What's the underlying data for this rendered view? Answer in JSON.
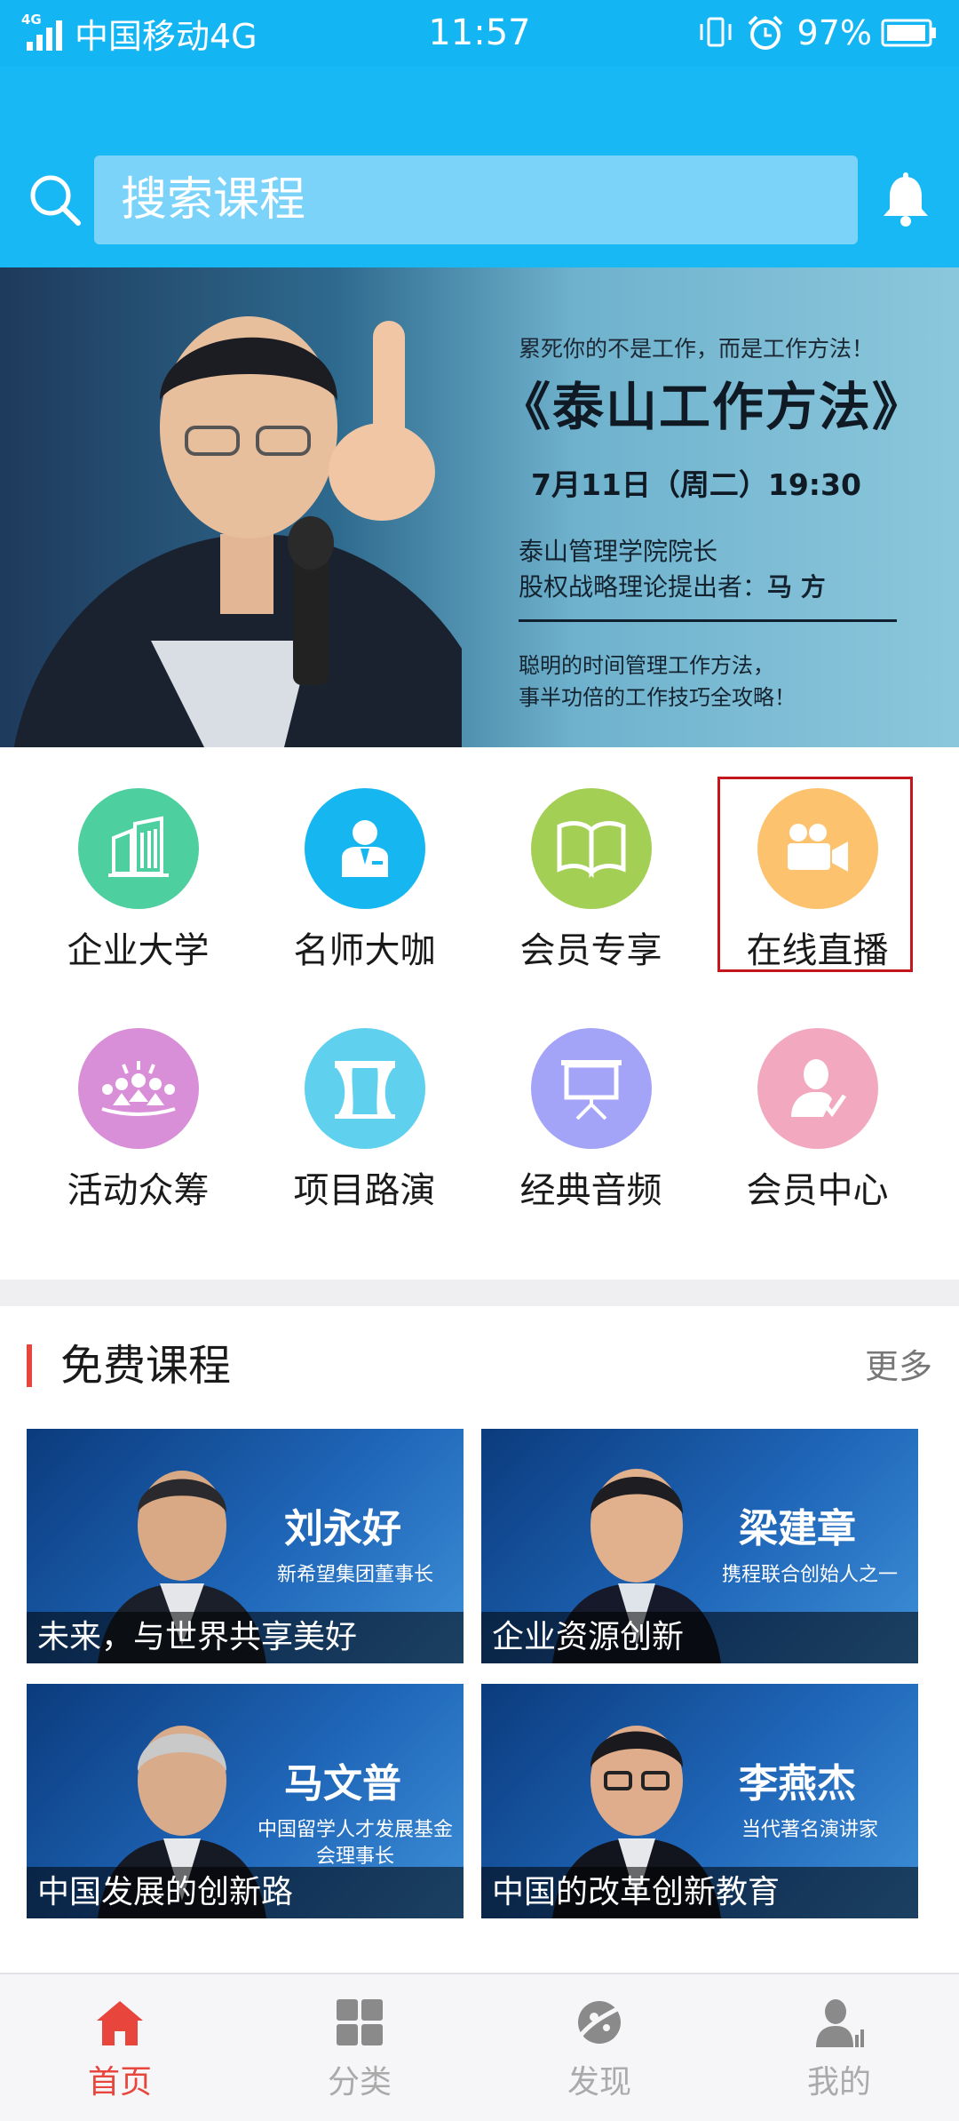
{
  "status_bar": {
    "network_tag": "4G",
    "carrier": "中国移动4G",
    "time": "11:57",
    "battery": "97%"
  },
  "search": {
    "placeholder": "搜索课程"
  },
  "banner": {
    "tagline": "累死你的不是工作，而是工作方法！",
    "title": "《泰山工作方法》",
    "date": "7月11日（周二）19:30",
    "line1": "泰山管理学院院长",
    "line2_prefix": "股权战略理论提出者：",
    "line2_name": "马 方",
    "line3": "聪明的时间管理工作方法，",
    "line4": "事半功倍的工作技巧全攻略！"
  },
  "grid": [
    {
      "label": "企业大学",
      "icon": "building-icon",
      "color": "#4dcf9f"
    },
    {
      "label": "名师大咖",
      "icon": "teacher-icon",
      "color": "#16b7f0"
    },
    {
      "label": "会员专享",
      "icon": "book-icon",
      "color": "#a3cf55"
    },
    {
      "label": "在线直播",
      "icon": "video-camera-icon",
      "color": "#fcc26d"
    },
    {
      "label": "活动众筹",
      "icon": "crowd-icon",
      "color": "#d98fd8"
    },
    {
      "label": "项目路演",
      "icon": "stage-icon",
      "color": "#5fd1ee"
    },
    {
      "label": "经典音频",
      "icon": "presentation-icon",
      "color": "#a3a3f7"
    },
    {
      "label": "会员中心",
      "icon": "member-icon",
      "color": "#f2a9bf"
    }
  ],
  "free_courses": {
    "title": "免费课程",
    "more": "更多",
    "cards": [
      {
        "name": "刘永好",
        "role": "新希望集团董事长",
        "caption": "未来，与世界共享美好"
      },
      {
        "name": "梁建章",
        "role": "携程联合创始人之一",
        "caption": "企业资源创新"
      },
      {
        "name": "马文普",
        "role": "中国留学人才发展基金会理事长",
        "caption": "中国发展的创新路"
      },
      {
        "name": "李燕杰",
        "role": "当代著名演讲家",
        "caption": "中国的改革创新教育"
      }
    ]
  },
  "bottom_nav": [
    {
      "label": "首页",
      "icon": "home-icon",
      "active": true
    },
    {
      "label": "分类",
      "icon": "grid-icon",
      "active": false
    },
    {
      "label": "发现",
      "icon": "discover-icon",
      "active": false
    },
    {
      "label": "我的",
      "icon": "profile-icon",
      "active": false
    }
  ],
  "colors": {
    "brand": "#18b8f4",
    "accent_red": "#e8453c",
    "highlight_border": "#c4161c",
    "nav_active": "#e8453c",
    "nav_inactive": "#aaaaaa"
  }
}
